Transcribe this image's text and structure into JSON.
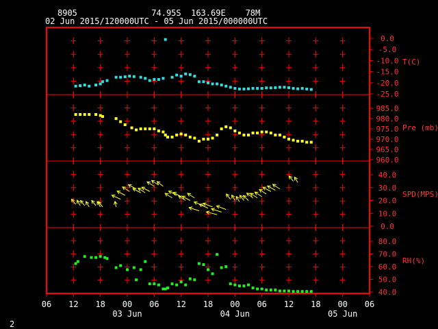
{
  "header": {
    "station": "8905",
    "lat": "74.95S",
    "lon": "163.69E",
    "elev": "78M",
    "period": "02 Jun 2015/120000UTC - 05 Jun 2015/000000UTC"
  },
  "page_number": "2",
  "colors": {
    "frame": "#ff0000",
    "temp": "#33dddd",
    "pressure": "#ffff22",
    "wind": "#ffff33",
    "rh": "#22ee22",
    "text": "#ffffff",
    "labels": "#ff3333"
  },
  "chart_data": {
    "type": "scatter",
    "x_unit": "hours since 02 Jun 06 UTC",
    "x_range": [
      0,
      72
    ],
    "x_tick_labels": [
      "06",
      "12",
      "18",
      "00",
      "06",
      "12",
      "18",
      "00",
      "06",
      "12",
      "18",
      "00",
      "06"
    ],
    "date_labels": [
      {
        "at": 18,
        "text": "03 Jun"
      },
      {
        "at": 42,
        "text": "04 Jun"
      },
      {
        "at": 66,
        "text": "05 Jun"
      }
    ],
    "panels": [
      {
        "key": "temp",
        "label": "T(C)",
        "ticks": [
          "0.0",
          "-5.0",
          "-10.0",
          "-15.0",
          "-20.0",
          "-25.0"
        ],
        "range": [
          -25,
          0
        ],
        "points": [
          [
            6.5,
            -21.5
          ],
          [
            7.5,
            -21.3
          ],
          [
            8.5,
            -21
          ],
          [
            9.5,
            -21.5
          ],
          [
            11,
            -21
          ],
          [
            12,
            -20.5
          ],
          [
            12.5,
            -19.5
          ],
          [
            13.5,
            -19
          ],
          [
            15.5,
            -17.5
          ],
          [
            16.5,
            -17.5
          ],
          [
            17.5,
            -17.3
          ],
          [
            18.5,
            -17
          ],
          [
            19.5,
            -17.2
          ],
          [
            21,
            -17.5
          ],
          [
            22,
            -18
          ],
          [
            23,
            -19
          ],
          [
            24,
            -18.5
          ],
          [
            25,
            -18.5
          ],
          [
            26,
            -18
          ],
          [
            26.5,
            -0.5
          ],
          [
            28,
            -17.5
          ],
          [
            29,
            -16.5
          ],
          [
            30,
            -17
          ],
          [
            31,
            -16
          ],
          [
            32,
            -16.3
          ],
          [
            33,
            -17
          ],
          [
            34,
            -19.5
          ],
          [
            35,
            -19.5
          ],
          [
            36,
            -20
          ],
          [
            37,
            -20.5
          ],
          [
            38,
            -20.5
          ],
          [
            39,
            -21
          ],
          [
            40,
            -21.5
          ],
          [
            41,
            -22
          ],
          [
            42,
            -22.5
          ],
          [
            43,
            -22.8
          ],
          [
            44,
            -22.8
          ],
          [
            45,
            -22.7
          ],
          [
            46,
            -22.5
          ],
          [
            47,
            -22.5
          ],
          [
            48,
            -22.5
          ],
          [
            49,
            -22.3
          ],
          [
            50,
            -22.3
          ],
          [
            51,
            -22.2
          ],
          [
            52,
            -22
          ],
          [
            53,
            -22
          ],
          [
            54,
            -22.2
          ],
          [
            55,
            -22.5
          ],
          [
            56,
            -22.7
          ],
          [
            57,
            -22.5
          ],
          [
            58,
            -22.8
          ],
          [
            59,
            -23
          ]
        ]
      },
      {
        "key": "pressure",
        "label": "Pre (mb)",
        "ticks": [
          "985.0",
          "980.0",
          "975.0",
          "970.0",
          "965.0",
          "960.0"
        ],
        "range": [
          960,
          985
        ],
        "points": [
          [
            6.5,
            982
          ],
          [
            7.5,
            982
          ],
          [
            8.5,
            982
          ],
          [
            9.5,
            982
          ],
          [
            11,
            982
          ],
          [
            12,
            981.5
          ],
          [
            12.5,
            981
          ],
          [
            15.5,
            980
          ],
          [
            16.5,
            978.5
          ],
          [
            17.5,
            977
          ],
          [
            19,
            975.5
          ],
          [
            20,
            974.5
          ],
          [
            21,
            975
          ],
          [
            22,
            975
          ],
          [
            23,
            975
          ],
          [
            24,
            975
          ],
          [
            25,
            974
          ],
          [
            26,
            973.5
          ],
          [
            26.5,
            972
          ],
          [
            27,
            971
          ],
          [
            28,
            971
          ],
          [
            29,
            972
          ],
          [
            30,
            972.5
          ],
          [
            31,
            972
          ],
          [
            32,
            971
          ],
          [
            33,
            970.5
          ],
          [
            34,
            969
          ],
          [
            35,
            970
          ],
          [
            36,
            970
          ],
          [
            37,
            970.5
          ],
          [
            38,
            972
          ],
          [
            39,
            975
          ],
          [
            40,
            976
          ],
          [
            41,
            975.5
          ],
          [
            42,
            974
          ],
          [
            43,
            973
          ],
          [
            44,
            972
          ],
          [
            45,
            972
          ],
          [
            46,
            973
          ],
          [
            47,
            973
          ],
          [
            48,
            973.5
          ],
          [
            49,
            973.5
          ],
          [
            50,
            973
          ],
          [
            51,
            972
          ],
          [
            52,
            972
          ],
          [
            53,
            971
          ],
          [
            54,
            970
          ],
          [
            55,
            969.5
          ],
          [
            56,
            969
          ],
          [
            57,
            969
          ],
          [
            58,
            968.5
          ],
          [
            59,
            968.5
          ]
        ]
      },
      {
        "key": "wind",
        "label": "SPD(MPS)",
        "ticks": [
          "40.0",
          "30.0",
          "20.0",
          "10.0",
          "0.0"
        ],
        "range": [
          0,
          40
        ],
        "points": [
          [
            6.5,
            17,
            200
          ],
          [
            7.5,
            16,
            195
          ],
          [
            8.5,
            16,
            200
          ],
          [
            9.5,
            15,
            195
          ],
          [
            11,
            16,
            200
          ],
          [
            12,
            15,
            195
          ],
          [
            12.5,
            15,
            200
          ],
          [
            15.5,
            15,
            185
          ],
          [
            16.5,
            21,
            225
          ],
          [
            17.5,
            24,
            220
          ],
          [
            18.5,
            27,
            215
          ],
          [
            20,
            29,
            220
          ],
          [
            21,
            26,
            220
          ],
          [
            22,
            26,
            215
          ],
          [
            23,
            27,
            220
          ],
          [
            24,
            31,
            215
          ],
          [
            25,
            32,
            215
          ],
          [
            26,
            31,
            210
          ],
          [
            28,
            22,
            215
          ],
          [
            29,
            24,
            220
          ],
          [
            30,
            23,
            220
          ],
          [
            31,
            20,
            215
          ],
          [
            32,
            20,
            220
          ],
          [
            33,
            22,
            215
          ],
          [
            34,
            12,
            235
          ],
          [
            35,
            16,
            230
          ],
          [
            36,
            14,
            225
          ],
          [
            37,
            15,
            230
          ],
          [
            38,
            9,
            240
          ],
          [
            39,
            11,
            235
          ],
          [
            40,
            13,
            230
          ],
          [
            41,
            21,
            200
          ],
          [
            42,
            20,
            195
          ],
          [
            43,
            19,
            195
          ],
          [
            44,
            20,
            200
          ],
          [
            45,
            20,
            205
          ],
          [
            46,
            22,
            210
          ],
          [
            47,
            22,
            215
          ],
          [
            48,
            23,
            215
          ],
          [
            49,
            25,
            215
          ],
          [
            50,
            27,
            220
          ],
          [
            51,
            28,
            220
          ],
          [
            52,
            29,
            215
          ],
          [
            55,
            35,
            200
          ],
          [
            56,
            34,
            195
          ]
        ]
      },
      {
        "key": "rh",
        "label": "RH(%)",
        "ticks": [
          "80.0",
          "70.0",
          "60.0",
          "50.0",
          "40.0"
        ],
        "range": [
          40,
          90
        ],
        "points": [
          [
            6.5,
            68
          ],
          [
            7,
            70
          ],
          [
            8.5,
            75
          ],
          [
            10,
            74
          ],
          [
            11,
            74
          ],
          [
            12,
            75
          ],
          [
            13,
            74
          ],
          [
            13.5,
            73
          ],
          [
            15.5,
            64
          ],
          [
            16.5,
            66
          ],
          [
            18,
            62
          ],
          [
            19.5,
            64
          ],
          [
            20,
            52
          ],
          [
            21,
            62
          ],
          [
            22,
            70
          ],
          [
            23,
            48
          ],
          [
            24,
            48
          ],
          [
            25,
            47
          ],
          [
            26,
            43
          ],
          [
            26.5,
            43
          ],
          [
            27,
            44
          ],
          [
            28,
            48
          ],
          [
            29,
            47
          ],
          [
            30,
            50
          ],
          [
            31,
            47
          ],
          [
            32,
            53
          ],
          [
            33,
            52
          ],
          [
            34,
            68
          ],
          [
            35,
            67
          ],
          [
            36,
            62
          ],
          [
            37,
            58
          ],
          [
            38,
            77
          ],
          [
            39,
            64
          ],
          [
            40,
            65
          ],
          [
            41,
            48
          ],
          [
            42,
            47
          ],
          [
            43,
            46
          ],
          [
            44,
            46
          ],
          [
            45,
            47
          ],
          [
            46,
            44
          ],
          [
            47,
            43
          ],
          [
            48,
            43
          ],
          [
            49,
            42
          ],
          [
            50,
            42
          ],
          [
            51,
            42
          ],
          [
            52,
            41
          ],
          [
            53,
            41
          ],
          [
            54,
            41
          ],
          [
            55,
            40.5
          ],
          [
            56,
            40.5
          ],
          [
            57,
            40.5
          ],
          [
            58,
            40.5
          ],
          [
            59,
            40.5
          ]
        ]
      }
    ]
  }
}
